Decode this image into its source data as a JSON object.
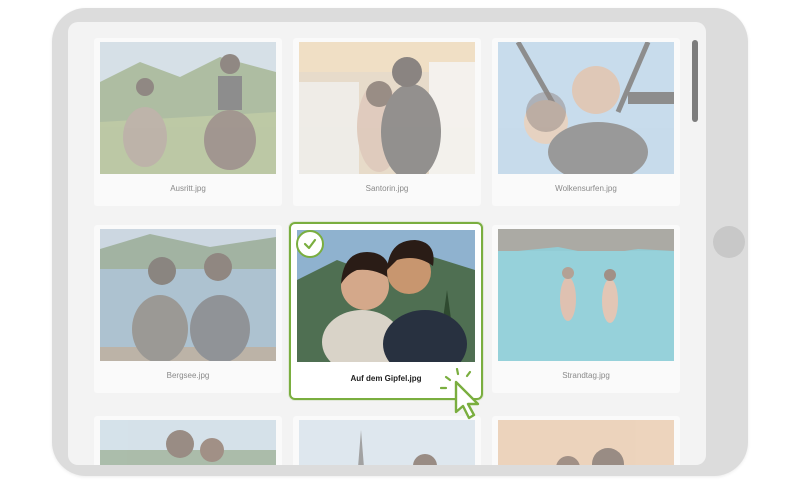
{
  "gallery": {
    "items": [
      {
        "filename": "Ausritt.jpg",
        "selected": false
      },
      {
        "filename": "Santorin.jpg",
        "selected": false
      },
      {
        "filename": "Wolkensurfen.jpg",
        "selected": false
      },
      {
        "filename": "Bergsee.jpg",
        "selected": false
      },
      {
        "filename": "Auf dem Gipfel.jpg",
        "selected": true
      },
      {
        "filename": "Strandtag.jpg",
        "selected": false
      }
    ]
  },
  "colors": {
    "accent": "#7aae3f",
    "tablet_frame": "#dcdcdc",
    "screen_bg": "#f3f3f3"
  },
  "icons": {
    "selection": "check-icon",
    "pointer": "hand-pointer-icon"
  }
}
